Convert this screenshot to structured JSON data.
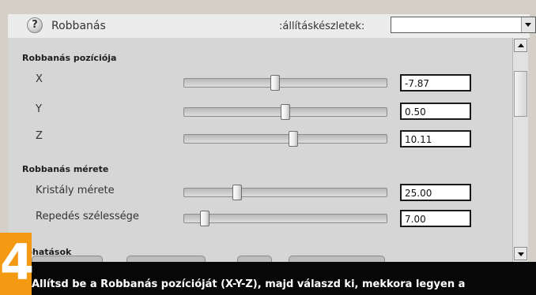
{
  "header": {
    "help_icon": "help-icon",
    "title": "Robbanás",
    "preset_label": ":állításkészletek:",
    "preset_value": ""
  },
  "sections": {
    "position_title": "Robbanás pozíciója",
    "size_title": "Robbanás mérete",
    "effects_title": "rőhatások"
  },
  "params": {
    "x": {
      "label": "X",
      "value": "-7.87",
      "slider_level": 0.45
    },
    "y": {
      "label": "Y",
      "value": "0.50",
      "slider_level": 0.5
    },
    "z": {
      "label": "Z",
      "value": "10.11",
      "slider_level": 0.54
    },
    "crystal": {
      "label": "Kristály mérete",
      "value": "25.00",
      "slider_level": 0.26
    },
    "crack": {
      "label": "Repedés szélessége",
      "value": "7.00",
      "slider_level": 0.1
    }
  },
  "badge": {
    "number": "4",
    "color": "#f39a12"
  },
  "caption": "Állítsd be a Robbanás pozícióját (X-Y-Z), majd válaszd ki, mekkora legyen a"
}
